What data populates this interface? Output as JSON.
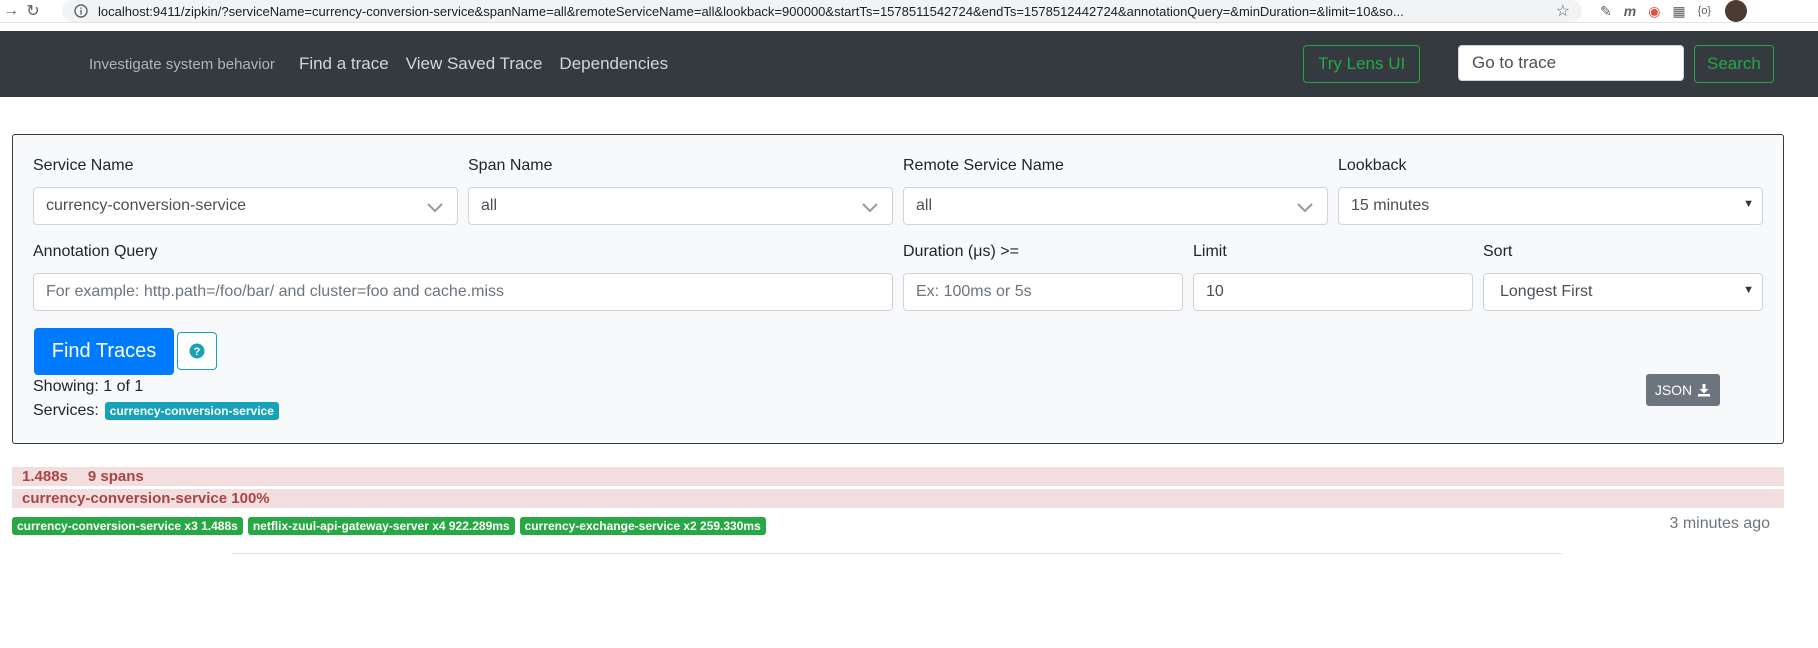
{
  "browser": {
    "url": "localhost:9411/zipkin/?serviceName=currency-conversion-service&spanName=all&remoteServiceName=all&lookback=900000&startTs=1578511542724&endTs=1578512442724&annotationQuery=&minDuration=&limit=10&so..."
  },
  "navbar": {
    "brand": "Investigate system behavior",
    "links": [
      "Find a trace",
      "View Saved Trace",
      "Dependencies"
    ],
    "lens_button": "Try Lens UI",
    "trace_input_placeholder": "Go to trace",
    "search_button": "Search"
  },
  "search": {
    "service_name": {
      "label": "Service Name",
      "value": "currency-conversion-service"
    },
    "span_name": {
      "label": "Span Name",
      "value": "all"
    },
    "remote_service_name": {
      "label": "Remote Service Name",
      "value": "all"
    },
    "lookback": {
      "label": "Lookback",
      "value": "15 minutes"
    },
    "annotation_query": {
      "label": "Annotation Query",
      "placeholder": "For example: http.path=/foo/bar/ and cluster=foo and cache.miss"
    },
    "duration": {
      "label": "Duration (μs) >=",
      "placeholder": "Ex: 100ms or 5s"
    },
    "limit": {
      "label": "Limit",
      "value": "10"
    },
    "sort": {
      "label": "Sort",
      "value": "Longest First"
    },
    "find_button": "Find Traces",
    "help_icon": "question-circle-icon"
  },
  "results": {
    "showing": "Showing: 1 of 1",
    "services_label": "Services:",
    "services_badge": "currency-conversion-service",
    "json_button": "JSON",
    "trace": {
      "duration": "1.488s",
      "spans": "9 spans",
      "service_percent": "currency-conversion-service 100%",
      "service_badges": [
        "currency-conversion-service x3 1.488s",
        "netflix-zuul-api-gateway-server x4 922.289ms",
        "currency-exchange-service x2 259.330ms"
      ],
      "time_ago": "3 minutes ago"
    }
  },
  "colors": {
    "navbar_bg": "#343a40",
    "primary": "#007bff",
    "success": "#28a745",
    "info": "#17a2b8",
    "danger_bg": "#f2dede",
    "danger_text": "#a94442"
  }
}
